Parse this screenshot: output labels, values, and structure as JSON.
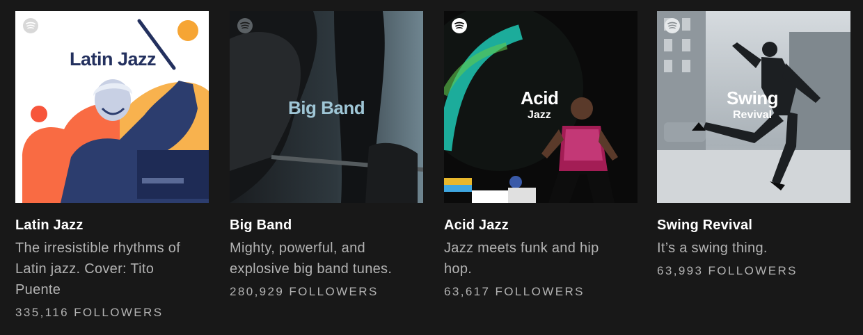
{
  "playlists": [
    {
      "cover_title": "Latin Jazz",
      "cover_subtitle": "",
      "title": "Latin Jazz",
      "description": "The irresistible rhythms of Latin jazz. Cover: Tito Puente",
      "followers": "335,116 FOLLOWERS",
      "accent": "#f7553b",
      "icon": "spotify-logo-icon"
    },
    {
      "cover_title": "Big Band",
      "cover_subtitle": "",
      "title": "Big Band",
      "description": "Mighty, powerful, and explosive big band tunes.",
      "followers": "280,929 FOLLOWERS",
      "accent": "#9fc6d6",
      "icon": "spotify-logo-icon"
    },
    {
      "cover_title": "Acid",
      "cover_subtitle": "Jazz",
      "title": "Acid Jazz",
      "description": "Jazz meets funk and hip hop.",
      "followers": "63,617 FOLLOWERS",
      "accent": "#1fc7b4",
      "icon": "spotify-logo-icon"
    },
    {
      "cover_title": "Swing",
      "cover_subtitle": "Revival",
      "title": "Swing Revival",
      "description": "It’s a swing thing.",
      "followers": "63,993 FOLLOWERS",
      "accent": "#c9cfd4",
      "icon": "spotify-logo-icon"
    }
  ]
}
